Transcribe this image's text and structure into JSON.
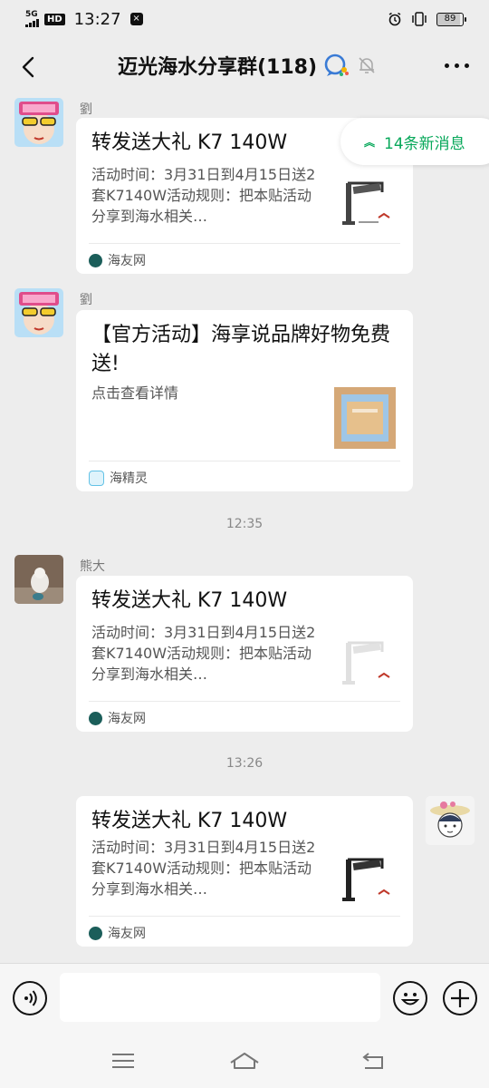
{
  "status_bar": {
    "network": "5G",
    "hd": "HD",
    "time": "13:27",
    "battery": "89"
  },
  "header": {
    "title": "迈光海水分享群(118)"
  },
  "new_messages_pill": "14条新消息",
  "messages": [
    {
      "sender": "劉",
      "card_title": "转发送大礼 K7 140W",
      "card_desc": "活动时间：3月31日到4月15日送2套K7140W活动规则：把本贴活动分享到海水相关…",
      "source": "海友网"
    },
    {
      "sender": "劉",
      "card_title": "【官方活动】海享说品牌好物免费送!",
      "card_desc": "点击查看详情",
      "source": "海精灵"
    },
    {
      "timestamp": "12:35"
    },
    {
      "sender": "熊大",
      "card_title": "转发送大礼 K7 140W",
      "card_desc": "活动时间：3月31日到4月15日送2套K7140W活动规则：把本贴活动分享到海水相关…",
      "source": "海友网"
    },
    {
      "timestamp": "13:26"
    },
    {
      "sender": "me",
      "card_title": "转发送大礼 K7 140W",
      "card_desc": "活动时间：3月31日到4月15日送2套K7140W活动规则：把本贴活动分享到海水相关…",
      "source": "海友网"
    }
  ],
  "input": {
    "placeholder": ""
  },
  "colors": {
    "accent": "#07a85a",
    "background": "#ededed",
    "card": "#ffffff"
  },
  "icons": [
    "back-arrow-icon",
    "ai-chat-icon",
    "mute-bell-icon",
    "more-icon",
    "voice-icon",
    "emoji-icon",
    "plus-icon",
    "menu-icon",
    "home-icon",
    "back-nav-icon"
  ]
}
